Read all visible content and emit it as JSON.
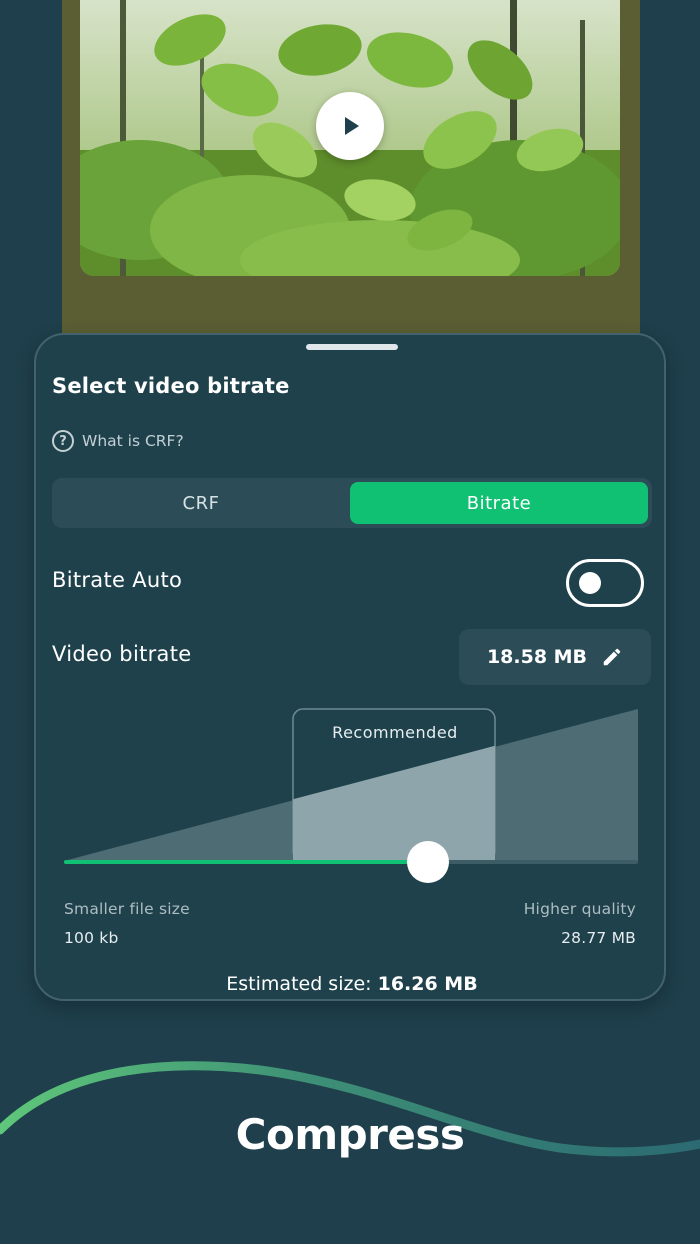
{
  "video": {
    "play_icon": "play-icon"
  },
  "sheet": {
    "title": "Select video bitrate",
    "help_link": "What is CRF?",
    "help_icon": "help-circle-icon",
    "modes": [
      {
        "label": "CRF",
        "selected": false
      },
      {
        "label": "Bitrate",
        "selected": true
      }
    ],
    "bitrate_auto": {
      "label": "Bitrate Auto",
      "on": false
    },
    "video_bitrate": {
      "label": "Video bitrate",
      "value": "18.58 MB",
      "edit_icon": "pencil-icon"
    },
    "slider": {
      "recommended_label": "Recommended",
      "min_label": "Smaller file size",
      "max_label": "Higher quality",
      "min_value": "100 kb",
      "max_value": "28.77 MB",
      "position_fraction": 0.64
    },
    "estimated": {
      "label": "Estimated size:",
      "value": "16.26 MB"
    }
  },
  "footer": {
    "title": "Compress"
  },
  "colors": {
    "background": "#1e3f4b",
    "accent": "#10c173",
    "card": "#1f414c",
    "chip": "#2c4d58"
  }
}
